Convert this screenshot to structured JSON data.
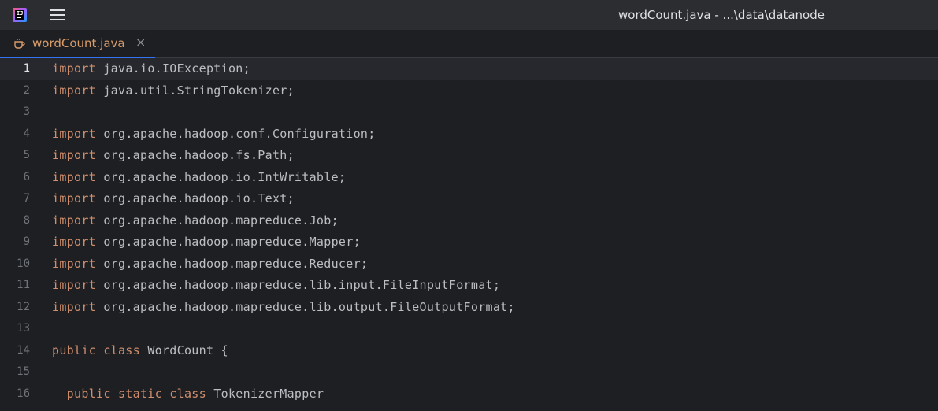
{
  "window": {
    "title": "wordCount.java - ...\\data\\datanode"
  },
  "app_icon": "intellij-idea-icon",
  "menu_icon": "hamburger-menu-icon",
  "tabs": [
    {
      "label": "wordCount.java",
      "icon": "java-file-icon",
      "close": "×",
      "active": true
    }
  ],
  "editor": {
    "current_line": 1,
    "lines": [
      {
        "num": "1",
        "kw": "import",
        "rest": " java.io.IOException;"
      },
      {
        "num": "2",
        "kw": "import",
        "rest": " java.util.StringTokenizer;"
      },
      {
        "num": "3",
        "kw": "",
        "rest": ""
      },
      {
        "num": "4",
        "kw": "import",
        "rest": " org.apache.hadoop.conf.Configuration;"
      },
      {
        "num": "5",
        "kw": "import",
        "rest": " org.apache.hadoop.fs.Path;"
      },
      {
        "num": "6",
        "kw": "import",
        "rest": " org.apache.hadoop.io.IntWritable;"
      },
      {
        "num": "7",
        "kw": "import",
        "rest": " org.apache.hadoop.io.Text;"
      },
      {
        "num": "8",
        "kw": "import",
        "rest": " org.apache.hadoop.mapreduce.Job;"
      },
      {
        "num": "9",
        "kw": "import",
        "rest": " org.apache.hadoop.mapreduce.Mapper;"
      },
      {
        "num": "10",
        "kw": "import",
        "rest": " org.apache.hadoop.mapreduce.Reducer;"
      },
      {
        "num": "11",
        "kw": "import",
        "rest": " org.apache.hadoop.mapreduce.lib.input.FileInputFormat;"
      },
      {
        "num": "12",
        "kw": "import",
        "rest": " org.apache.hadoop.mapreduce.lib.output.FileOutputFormat;"
      },
      {
        "num": "13",
        "kw": "",
        "rest": ""
      },
      {
        "num": "14",
        "kw": "public class",
        "rest": " WordCount {"
      },
      {
        "num": "15",
        "kw": "",
        "rest": ""
      },
      {
        "num": "16",
        "kw": "  public static class",
        "rest": " TokenizerMapper"
      }
    ]
  }
}
